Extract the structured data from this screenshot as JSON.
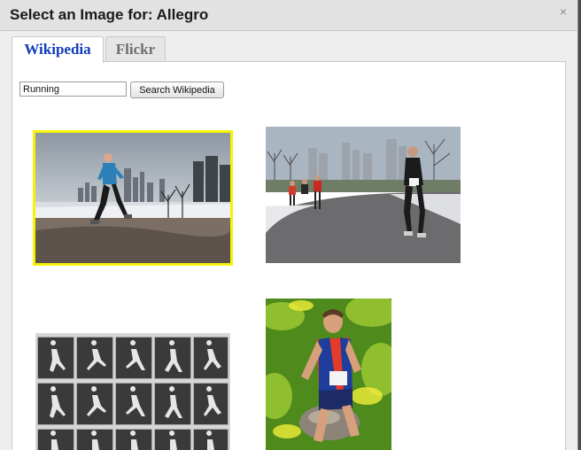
{
  "dialog": {
    "title": "Select an Image for: Allegro",
    "close_symbol": "×"
  },
  "tabs": [
    {
      "label": "Wikipedia",
      "active": true
    },
    {
      "label": "Flickr",
      "active": false
    }
  ],
  "search": {
    "value": "Running",
    "button_label": "Search Wikipedia"
  },
  "results": [
    {
      "subject": "runner-on-lakefront-photo",
      "selected": true
    },
    {
      "subject": "race-runners-on-road-photo",
      "selected": false
    },
    {
      "subject": "muybridge-running-sequence-photo",
      "selected": false
    },
    {
      "subject": "cross-country-runner-photo",
      "selected": false
    }
  ],
  "colors": {
    "selection_border": "#f7f20a",
    "active_tab_text": "#0f3dbb"
  }
}
